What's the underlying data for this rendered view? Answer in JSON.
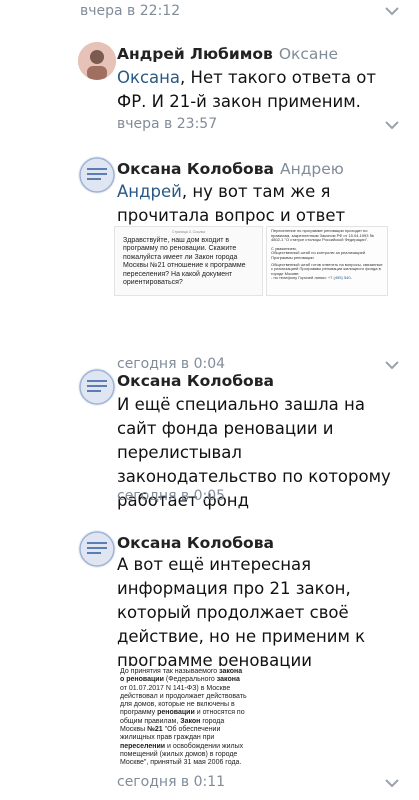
{
  "top": {
    "time": "вчера в 22:12"
  },
  "comments": [
    {
      "author": "Андрей Любимов",
      "reply_to": "Оксане",
      "mention": "Оксана",
      "text": ", Нет такого ответа от ФР. И 21-й закон применим.",
      "time": "вчера в 23:57"
    },
    {
      "author": "Оксана Колобова",
      "reply_to": "Андрею",
      "mention": "Андрей",
      "text": ", ну вот там же я прочитала вопрос и ответ",
      "time": "сегодня в 0:04",
      "doc1": {
        "header": "Страница 3. Ссылка",
        "body": "Здравствуйте, наш дом входит в программу по реновации. Скажите пожалуйста имеет ли Закон города Москвы №21 отношение к программе переселения? На какой документ ориентироваться?"
      },
      "doc2": {
        "body1": "Переселение по программе реновации проходит по правилам, закрепленным Законом РФ от 15.04.1993 № 4802-1 \"О статусе столицы Российской Федерации\".",
        "body2": "С уважением,",
        "body3": "Общественный штаб по контролю за реализацией Программы реновации",
        "body4": "Общественный штаб готов ответить на вопросы, связанные с реализацией Программы реновации жилищного фонда в городе Москве:",
        "body5": "- по телефону Горячей линии:",
        "phone": "+7 (495) 540-"
      }
    },
    {
      "author": "Оксана Колобова",
      "text": "И ещё специально зашла на сайт фонда реновации и перелистывал законодательство по которому работает фонд",
      "time": "сегодня в 0:05"
    },
    {
      "author": "Оксана Колобова",
      "text": "А вот ещё интересная информация про 21 закон, который продолжает своё действие, но не применим к программе реновации",
      "time": "сегодня в 0:11",
      "doc": {
        "p1a": "До принятия так называемого ",
        "p1b": "закона о реновации",
        "p1c": " (Федерального ",
        "p1d": "закона",
        "p1e": " от 01.07.2017 N 141-ФЗ) в Москве действовал и продолжает действовать для домов, которые не включены в программу ",
        "p1f": "реновации",
        "p1g": " и относятся по общим правилам, ",
        "p1h": "Закон",
        "p1i": " города Москвы ",
        "p1j": "№21",
        "p1k": " \"Об обеспечении жилищных прав граждан при ",
        "p1l": "переселении",
        "p1m": " и освобождении жилых помещений (жилых домов) в городе Москве\", принятый 31 мая 2006 года."
      }
    }
  ],
  "colors": {
    "link": "#2a5885",
    "meta": "#818c99"
  },
  "icons": {
    "menu": "more-vertical-icon"
  }
}
